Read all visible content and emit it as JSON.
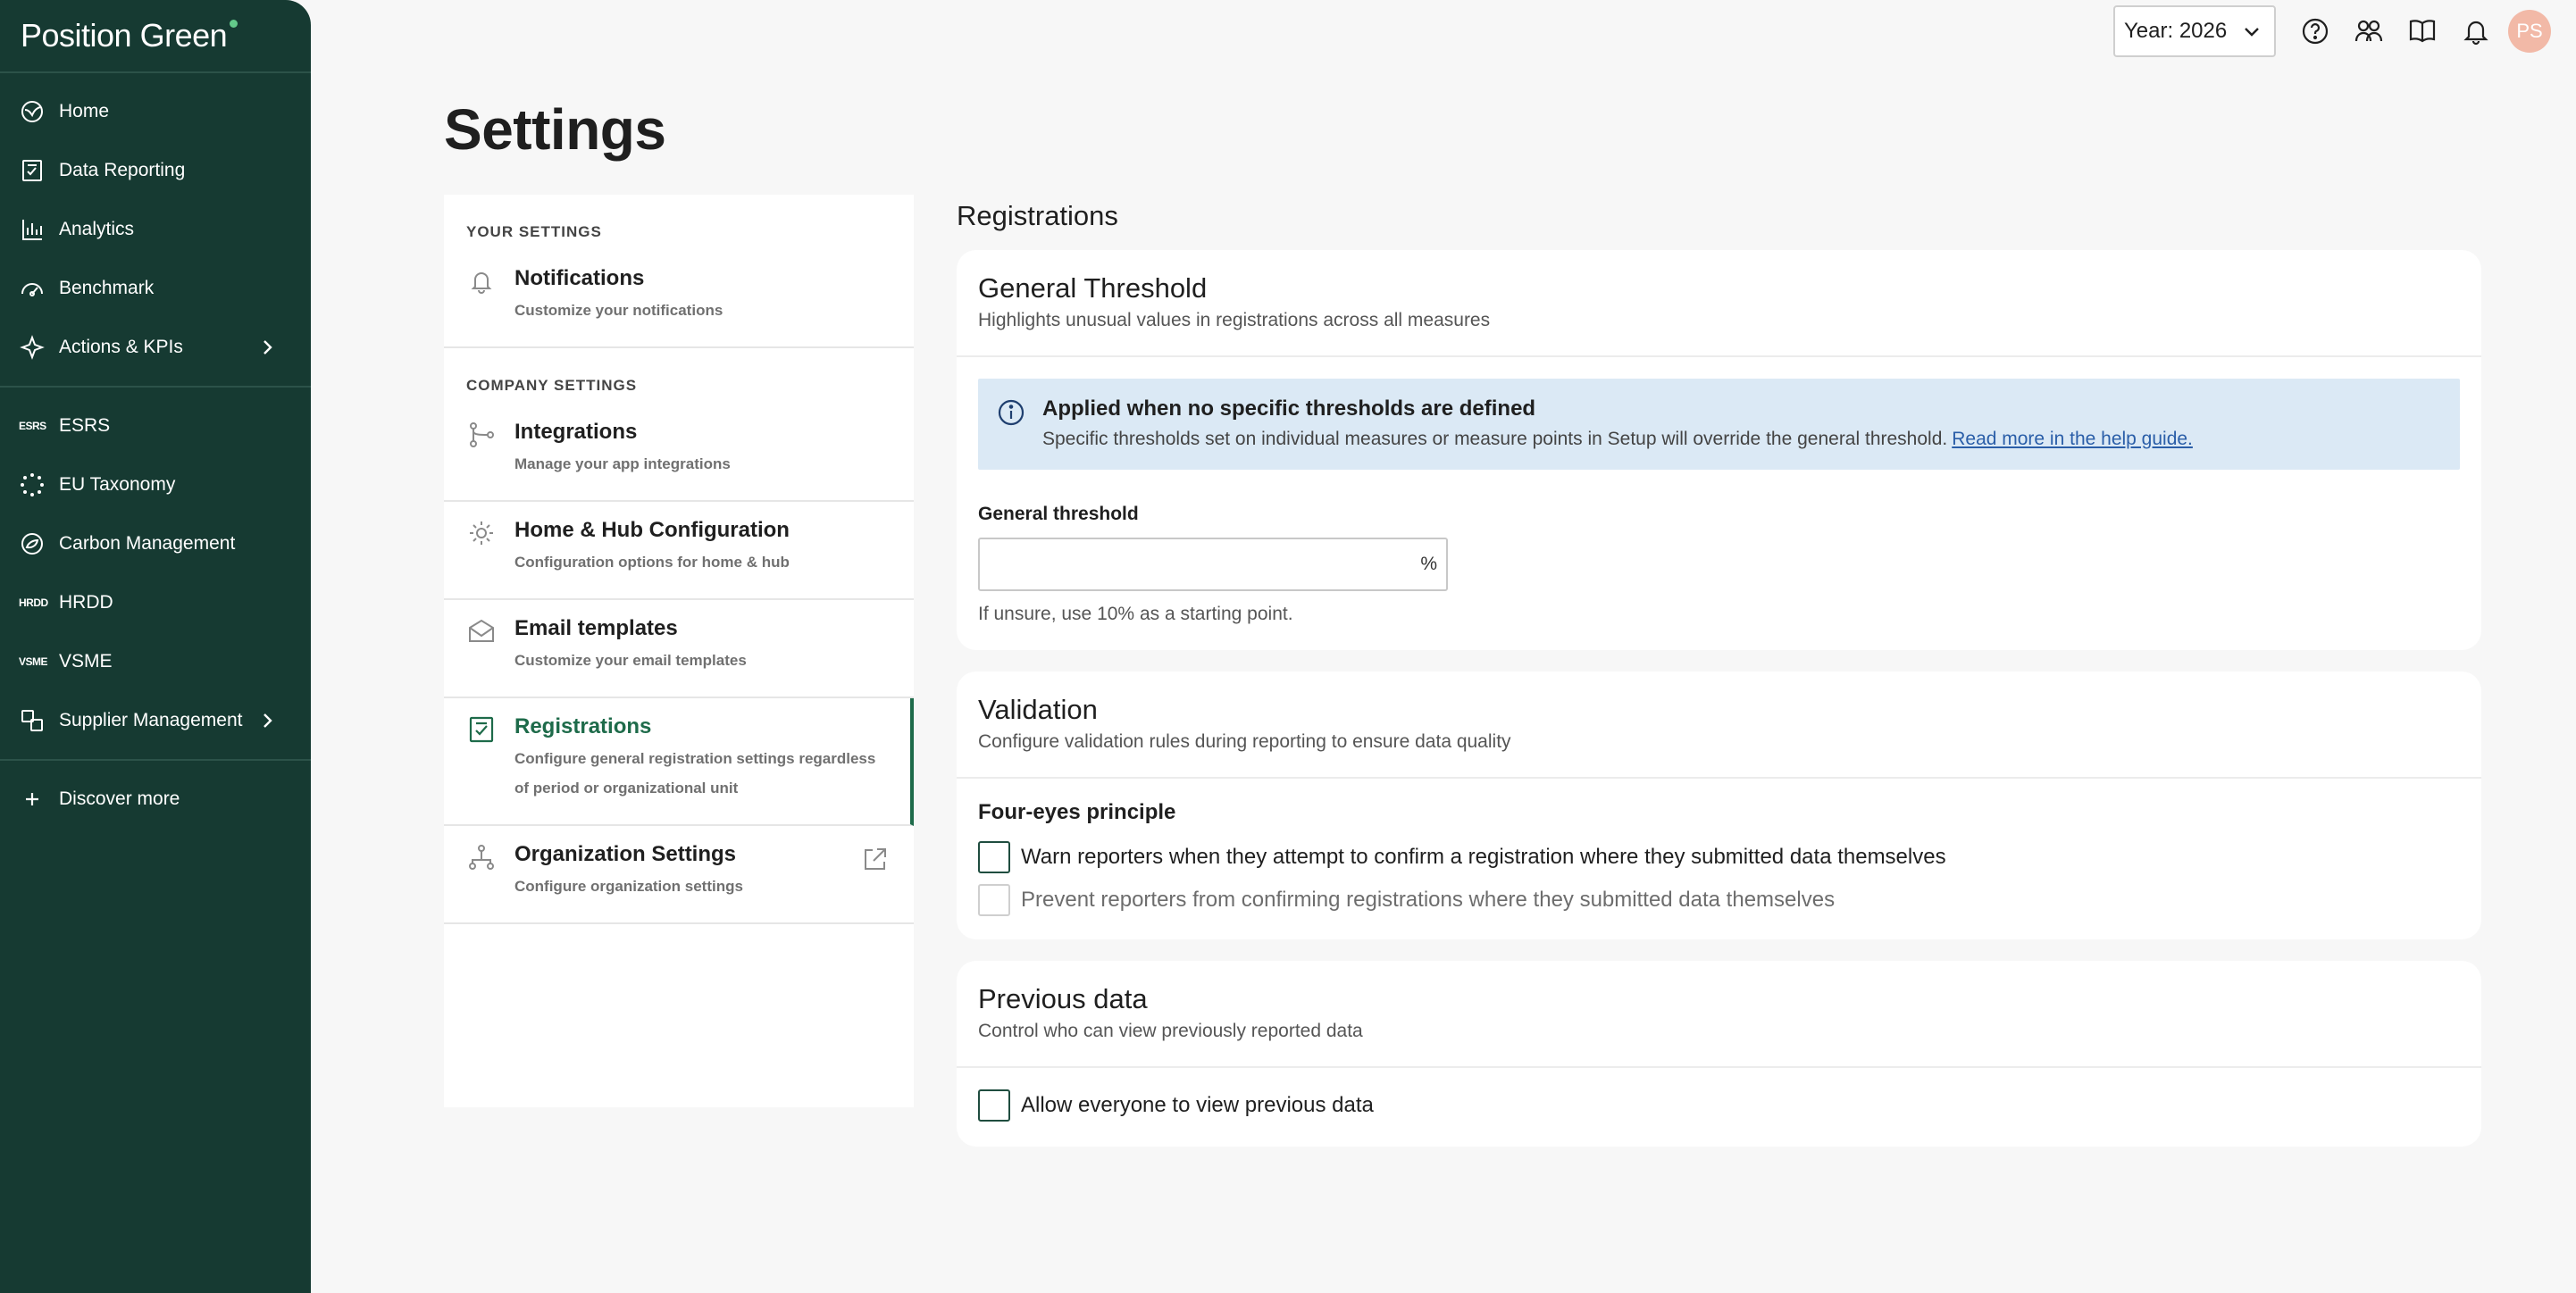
{
  "brand": {
    "name": "Position Green",
    "accent": "#63c98a",
    "sidebar_bg": "#163a32",
    "active_color": "#1e6b4a"
  },
  "sidebar": {
    "groups": [
      [
        {
          "label": "Home",
          "icon": "home-icon"
        },
        {
          "label": "Data Reporting",
          "icon": "data-reporting-icon"
        },
        {
          "label": "Analytics",
          "icon": "analytics-icon"
        },
        {
          "label": "Benchmark",
          "icon": "benchmark-icon"
        },
        {
          "label": "Actions & KPIs",
          "icon": "actions-icon",
          "has_children": true
        }
      ],
      [
        {
          "label": "ESRS",
          "abbr": "ESRS"
        },
        {
          "label": "EU Taxonomy",
          "icon": "eu-taxonomy-icon"
        },
        {
          "label": "Carbon Management",
          "icon": "carbon-icon"
        },
        {
          "label": "HRDD",
          "abbr": "HRDD"
        },
        {
          "label": "VSME",
          "abbr": "VSME"
        },
        {
          "label": "Supplier Management",
          "icon": "supplier-icon",
          "has_children": true
        }
      ],
      [
        {
          "label": "Discover more",
          "icon": "plus-icon"
        }
      ]
    ]
  },
  "topbar": {
    "year_label": "Year: 2026",
    "avatar_initials": "PS"
  },
  "page": {
    "title": "Settings"
  },
  "settings_menu": {
    "your_settings_title": "YOUR SETTINGS",
    "company_settings_title": "COMPANY SETTINGS",
    "notifications": {
      "title": "Notifications",
      "subtitle": "Customize your notifications"
    },
    "integrations": {
      "title": "Integrations",
      "subtitle": "Manage your app integrations"
    },
    "home_hub": {
      "title": "Home & Hub Configuration",
      "subtitle": "Configuration options for home & hub"
    },
    "email_templates": {
      "title": "Email templates",
      "subtitle": "Customize your email templates"
    },
    "registrations": {
      "title": "Registrations",
      "subtitle_line1": "Configure general registration settings regardless",
      "subtitle_line2": "of period or organizational unit"
    },
    "organization": {
      "title": "Organization Settings",
      "subtitle": "Configure organization settings"
    }
  },
  "content": {
    "heading": "Registrations",
    "general_threshold": {
      "title": "General Threshold",
      "subtitle": "Highlights unusual values in registrations across all measures",
      "info_title": "Applied when no specific thresholds are defined",
      "info_text": "Specific thresholds set on individual measures or measure points in Setup will override the general threshold.",
      "info_link": "Read more in the help guide.",
      "field_label": "General threshold",
      "field_value": "",
      "field_suffix": "%",
      "field_hint": "If unsure, use 10% as a starting point."
    },
    "validation": {
      "title": "Validation",
      "subtitle": "Configure validation rules during reporting to ensure data quality",
      "four_eyes_title": "Four-eyes principle",
      "warn_label": "Warn reporters when they attempt to confirm a registration where they submitted data themselves",
      "warn_checked": false,
      "prevent_label": "Prevent reporters from confirming registrations where they submitted data themselves",
      "prevent_checked": false,
      "prevent_disabled": true
    },
    "previous_data": {
      "title": "Previous data",
      "subtitle": "Control who can view previously reported data",
      "allow_label": "Allow everyone to view previous data",
      "allow_checked": false
    }
  }
}
